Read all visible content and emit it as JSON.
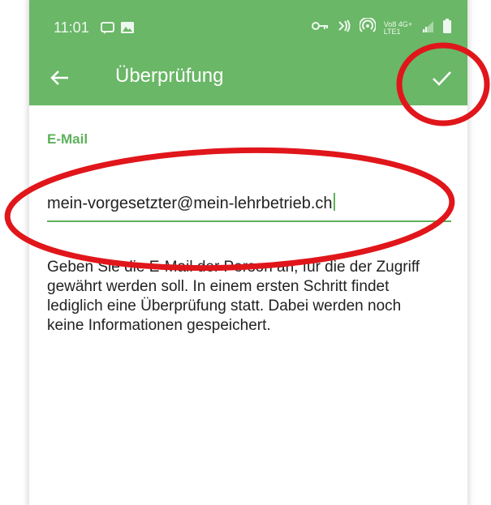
{
  "statusbar": {
    "time": "11:01",
    "left_icons": [
      "message-icon",
      "gallery-icon"
    ],
    "right_icons": [
      "vpn-key-icon",
      "nfc-icon",
      "hotspot-icon",
      "volte-icon",
      "signal-icon",
      "battery-icon"
    ],
    "volte_label": "Vo8 4G+",
    "lte_label": "LTE1"
  },
  "appbar": {
    "title": "Überprüfung",
    "back_icon": "arrow-left-icon",
    "confirm_icon": "check-icon"
  },
  "form": {
    "email_label": "E-Mail",
    "email_value": "mein-vorgesetzter@mein-lehrbetrieb.ch",
    "helper_text": "Geben Sie die E-Mail der Person an, für die der Zugriff gewährt werden soll. In einem ersten Schritt findet lediglich eine Überprüfung statt. Dabei werden noch keine Informationen gespeichert."
  },
  "colors": {
    "primary": "#6ab767",
    "accent_green": "#5db15a",
    "annotation_red": "#e0161b"
  }
}
